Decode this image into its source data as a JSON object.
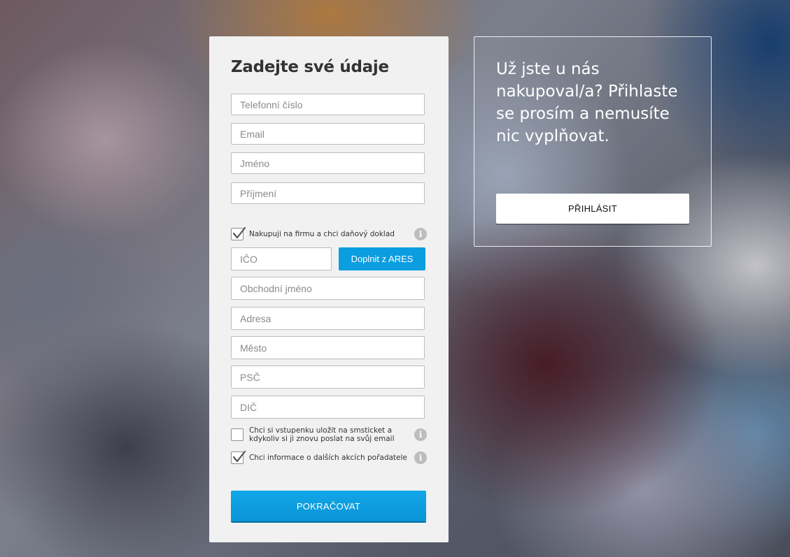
{
  "form": {
    "title": "Zadejte své údaje",
    "fields": {
      "phone": {
        "placeholder": "Telefonní číslo",
        "value": ""
      },
      "email": {
        "placeholder": "Email",
        "value": ""
      },
      "first_name": {
        "placeholder": "Jméno",
        "value": ""
      },
      "last_name": {
        "placeholder": "Příjmení",
        "value": ""
      }
    },
    "company_checkbox": {
      "label": "Nakupuji na firmu a chci daňový doklad",
      "checked": true
    },
    "company": {
      "ico": {
        "placeholder": "IČO",
        "value": ""
      },
      "ares_button": "Doplnit z ARES",
      "business_name": {
        "placeholder": "Obchodní jméno",
        "value": ""
      },
      "address": {
        "placeholder": "Adresa",
        "value": ""
      },
      "city": {
        "placeholder": "Město",
        "value": ""
      },
      "zip": {
        "placeholder": "PSČ",
        "value": ""
      },
      "dic": {
        "placeholder": "DIČ",
        "value": ""
      }
    },
    "smsticket_checkbox": {
      "label_line1": "Chci si vstupenku uložit na smsticket a",
      "label_line2": "kdykoliv si ji znovu poslat na svůj email",
      "checked": false
    },
    "newsletter_checkbox": {
      "label": "Chci informace o dalších akcích pořadatele",
      "checked": true
    },
    "info_icon_glyph": "i",
    "continue_button": "POKRAČOVAT"
  },
  "login": {
    "message": "Už jste u nás nakupoval/a? Přihlaste se prosím a nemusíte nic vyplňovat.",
    "login_button": "PŘIHLÁSIT"
  },
  "colors": {
    "primary_button": "#0a9de0",
    "card_background": "#f1f1f1"
  }
}
